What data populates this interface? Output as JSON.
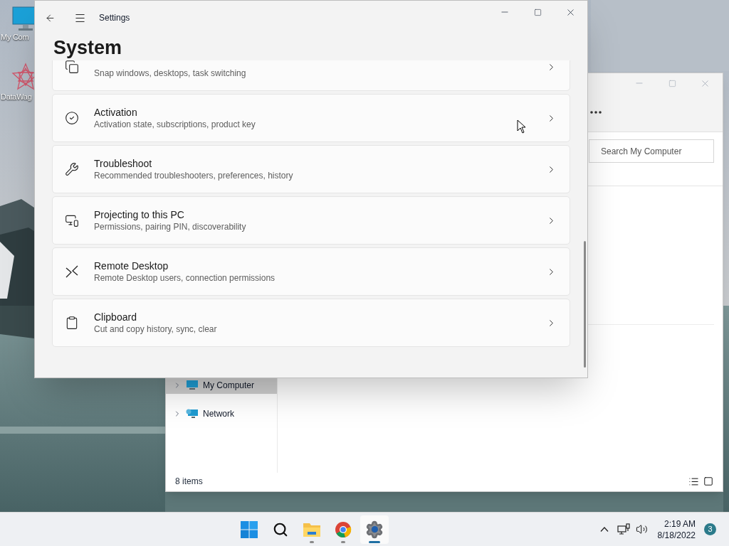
{
  "desktop": {
    "icons": [
      {
        "kind": "computer",
        "label": "My Com"
      },
      {
        "kind": "app",
        "label": "DataWag"
      }
    ]
  },
  "explorer_window": {
    "search": {
      "placeholder": "Search My Computer"
    },
    "nav_items": [
      {
        "kind": "computer",
        "label": "My Computer",
        "selected": true
      },
      {
        "kind": "network",
        "label": "Network",
        "selected": false
      }
    ],
    "status": "8 items"
  },
  "settings_window": {
    "title": "Settings",
    "heading": "System",
    "items": [
      {
        "kind": "snap",
        "description": "Snap windows, desktops, task switching"
      },
      {
        "kind": "activation",
        "title": "Activation",
        "description": "Activation state, subscriptions, product key"
      },
      {
        "kind": "troubleshoot",
        "title": "Troubleshoot",
        "description": "Recommended troubleshooters, preferences, history"
      },
      {
        "kind": "projecting",
        "title": "Projecting to this PC",
        "description": "Permissions, pairing PIN, discoverability"
      },
      {
        "kind": "remote",
        "title": "Remote Desktop",
        "description": "Remote Desktop users, connection permissions"
      },
      {
        "kind": "clipboard",
        "title": "Clipboard",
        "description": "Cut and copy history, sync, clear"
      }
    ]
  },
  "taskbar": {
    "apps": [
      {
        "kind": "start",
        "running": false,
        "selected": false
      },
      {
        "kind": "search",
        "running": false,
        "selected": false
      },
      {
        "kind": "files",
        "running": true,
        "selected": false
      },
      {
        "kind": "browser",
        "running": true,
        "selected": false
      },
      {
        "kind": "settings",
        "running": true,
        "selected": true
      }
    ],
    "time": "2:19 AM",
    "date": "8/18/2022",
    "notifications": "3"
  }
}
